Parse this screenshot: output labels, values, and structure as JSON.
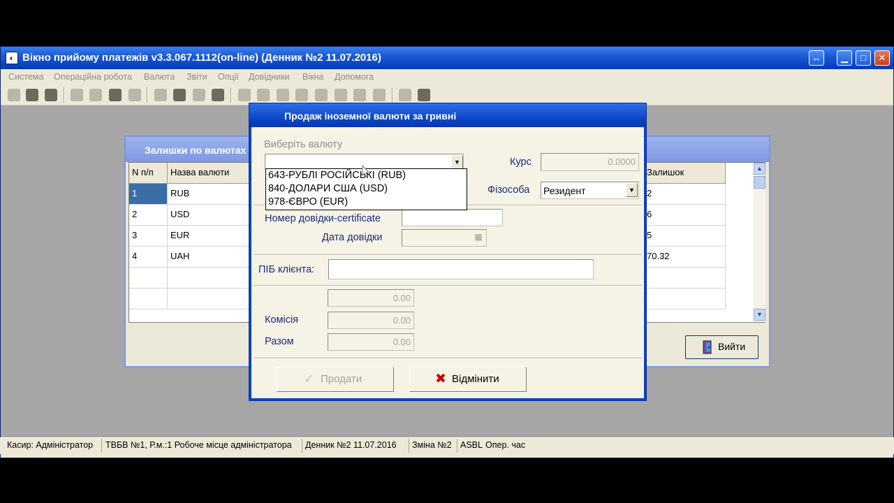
{
  "window": {
    "title": "Вікно прийому платежів v3.3.067.1112(on-line) (Денник №2 11.07.2016)",
    "controls": {
      "restore": "↔",
      "minimize": "▁",
      "maximize": "□",
      "close": "✕"
    }
  },
  "menu": {
    "items": [
      "Система",
      "Операційна робота",
      "Валюта",
      "Звіти",
      "Опції",
      "Довідники",
      "Вікна",
      "Допомога"
    ]
  },
  "toolbar": {
    "icons": [
      "arrow-icon",
      "key-icon",
      "money-icon",
      "document-icon",
      "envelope-icon",
      "card-icon",
      "paper-icon",
      "settings-icon",
      "star-icon",
      "lock-icon",
      "trash-icon",
      "plus-icon",
      "gear-icon",
      "grid-icon",
      "transfer-icon",
      "printer-icon",
      "message-icon",
      "chat-icon",
      "mail-icon",
      "copy-icon",
      "refresh-icon"
    ]
  },
  "balances_window": {
    "title": "Залишки по валютах",
    "columns": [
      "N п/п",
      "Назва валюти",
      "Залишок"
    ],
    "rows": [
      {
        "num": "1",
        "name": "RUB",
        "balance": "2"
      },
      {
        "num": "2",
        "name": "USD",
        "balance": "6"
      },
      {
        "num": "3",
        "name": "EUR",
        "balance": "5"
      },
      {
        "num": "4",
        "name": "UAH",
        "balance": "70.32"
      }
    ],
    "exit_label": "Вийти"
  },
  "dialog": {
    "title": "Продаж іноземної валюти за гривні",
    "currency_prompt": "Виберіть валюту",
    "currency_value": "",
    "currency_options": [
      "643-РУБЛІ РОСІЙСЬКІ (RUB)",
      "840-ДОЛАРИ США (USD)",
      "978-ЄВРО (EUR)"
    ],
    "rate_label": "Курс",
    "rate_value": "0.0000",
    "person_label": "Фізособа",
    "person_value": "Резидент",
    "certificate_number_label": "Номер довідки-certificate",
    "certificate_number_value": "",
    "certificate_date_label": "Дата довідки",
    "certificate_date_value": "",
    "client_name_label": "ПІБ клієнта:",
    "client_name_value": "",
    "amount_value": "0.00",
    "commission_label": "Комісія",
    "commission_value": "0.00",
    "total_label": "Разом",
    "total_value": "0.00",
    "sell_label": "Продати",
    "cancel_label": "Відмінити"
  },
  "status": {
    "cashier": "Касир: Адміністратор",
    "workplace": "ТВБВ №1, Р.м.:1 Робоче місце адміністратора",
    "journal": "Денник №2 11.07.2016",
    "shift": "Зміна №2",
    "system": "ASBL",
    "operating_time": "Опер. час"
  },
  "colors": {
    "titlebar": "#0a44c4",
    "dialog_background": "#f5f3e6",
    "selection": "#3a6ea5",
    "label_text": "#1b2b7a",
    "cancel_icon": "#c00000",
    "sell_icon": "#9aa"
  }
}
